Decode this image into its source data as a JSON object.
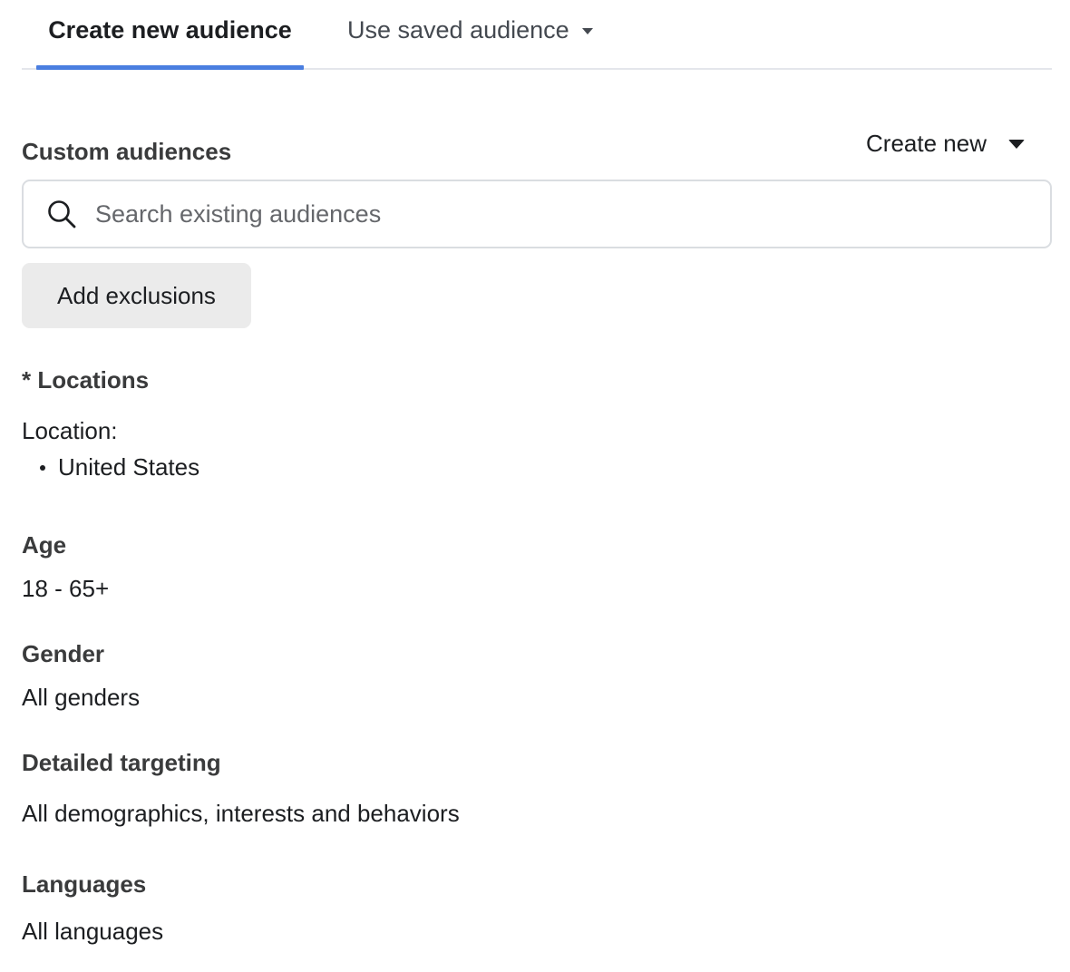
{
  "tabs": {
    "active_label": "Create new audience",
    "saved_label": "Use saved audience",
    "accent_color": "#4a7ee0"
  },
  "custom_audiences": {
    "label": "Custom audiences",
    "create_new_label": "Create new",
    "search_placeholder": "Search existing audiences",
    "search_value": "",
    "add_exclusions_label": "Add exclusions"
  },
  "locations": {
    "label": "* Locations",
    "sub_label": "Location:",
    "items": [
      "United States"
    ]
  },
  "age": {
    "label": "Age",
    "value": "18 - 65+"
  },
  "gender": {
    "label": "Gender",
    "value": "All genders"
  },
  "detailed_targeting": {
    "label": "Detailed targeting",
    "value": "All demographics, interests and behaviors"
  },
  "languages": {
    "label": "Languages",
    "value": "All languages"
  }
}
